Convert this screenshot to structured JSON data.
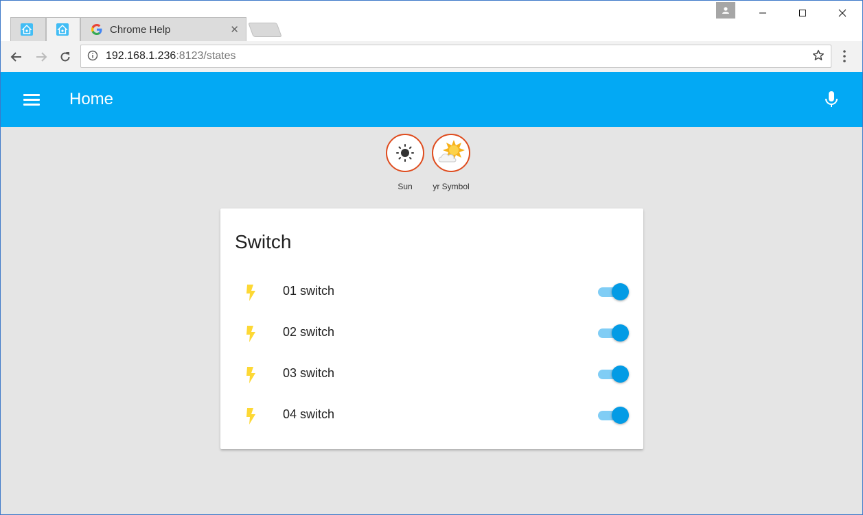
{
  "browser": {
    "tabs": [
      {
        "title": "",
        "favicon": "home-assistant-icon",
        "active": false
      },
      {
        "title": "",
        "favicon": "home-assistant-icon",
        "active": true
      },
      {
        "title": "Chrome Help",
        "favicon": "google-icon",
        "active": false
      }
    ],
    "address": {
      "host": "192.168.1.236",
      "port_path": ":8123/states"
    }
  },
  "app": {
    "title": "Home",
    "accent": "#03a9f4",
    "badges": [
      {
        "label": "Sun",
        "icon": "sun-icon"
      },
      {
        "label": "yr Symbol",
        "icon": "partly-cloudy-icon"
      }
    ],
    "card": {
      "title": "Switch",
      "items": [
        {
          "name": "01 switch",
          "icon": "flash-icon",
          "state": "on"
        },
        {
          "name": "02 switch",
          "icon": "flash-icon",
          "state": "on"
        },
        {
          "name": "03 switch",
          "icon": "flash-icon",
          "state": "on"
        },
        {
          "name": "04 switch",
          "icon": "flash-icon",
          "state": "on"
        }
      ]
    }
  }
}
